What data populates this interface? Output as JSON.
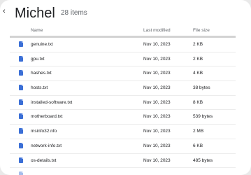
{
  "header": {
    "back_icon": "back-arrow-icon",
    "title": "Michel",
    "count": "28 items"
  },
  "columns": {
    "name": "Name",
    "modified": "Last modified",
    "size": "File size"
  },
  "files": [
    {
      "name": "genuine.txt",
      "modified": "Nov 10, 2023",
      "size": "2 KB",
      "icon": "document-icon"
    },
    {
      "name": "gpu.txt",
      "modified": "Nov 10, 2023",
      "size": "2 KB",
      "icon": "document-icon"
    },
    {
      "name": "hashes.txt",
      "modified": "Nov 10, 2023",
      "size": "4 KB",
      "icon": "document-icon"
    },
    {
      "name": "hosts.txt",
      "modified": "Nov 10, 2023",
      "size": "38 bytes",
      "icon": "document-icon"
    },
    {
      "name": "installed-software.txt",
      "modified": "Nov 10, 2023",
      "size": "8 KB",
      "icon": "document-icon"
    },
    {
      "name": "motherboard.txt",
      "modified": "Nov 10, 2023",
      "size": "539 bytes",
      "icon": "document-icon"
    },
    {
      "name": "msinfo32.nfo",
      "modified": "Nov 10, 2023",
      "size": "2 MB",
      "icon": "document-icon"
    },
    {
      "name": "network-info.txt",
      "modified": "Nov 10, 2023",
      "size": "6 KB",
      "icon": "document-icon"
    },
    {
      "name": "os-details.txt",
      "modified": "Nov 10, 2023",
      "size": "485 bytes",
      "icon": "document-icon"
    }
  ],
  "colors": {
    "accent_icon": "#3b6fd6",
    "background": "#ffffff",
    "header_rule": "#d3d3d3"
  }
}
